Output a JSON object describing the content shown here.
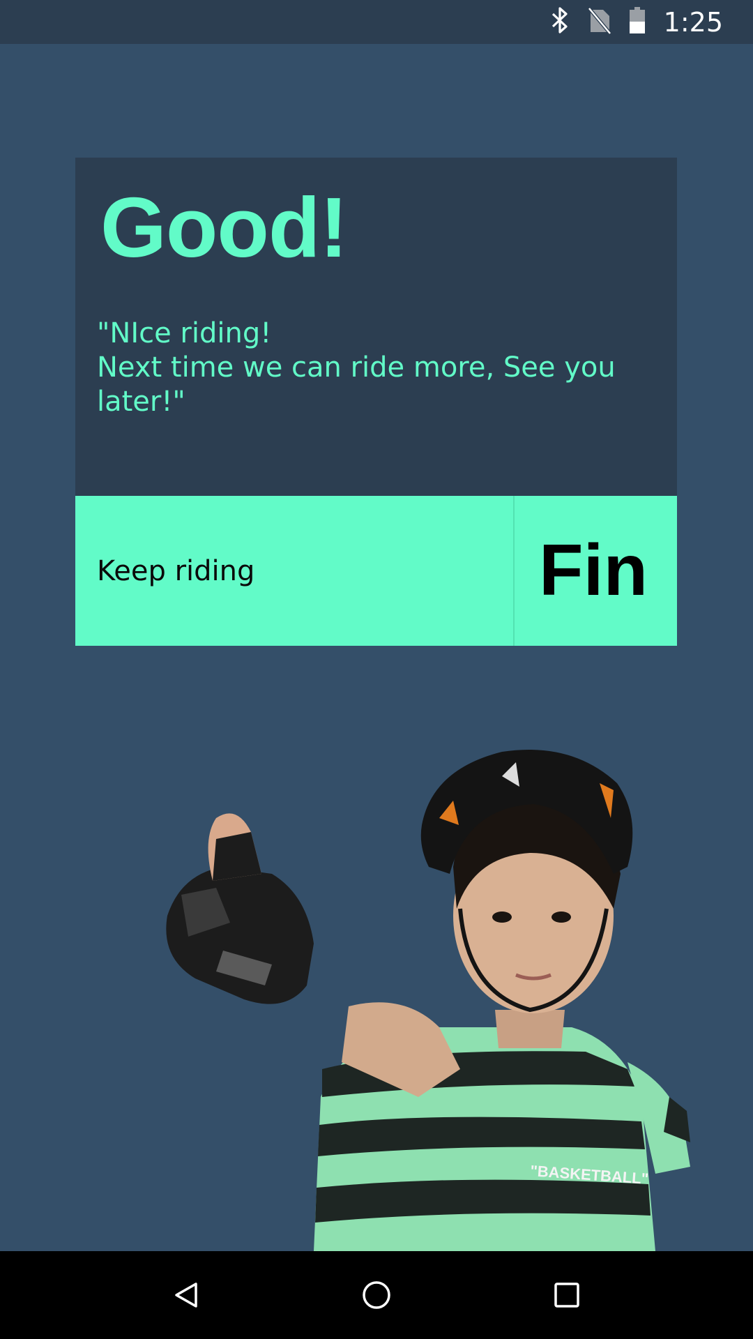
{
  "status_bar": {
    "time": "1:25",
    "icons": [
      "bluetooth-icon",
      "no-sim-icon",
      "battery-icon"
    ]
  },
  "card": {
    "title": "Good!",
    "message_line1": "\"NIce riding!",
    "message_line2": "Next time we can ride more, See you later!\"",
    "keep_label": "Keep riding",
    "fin_label": "Fin"
  },
  "illustration": {
    "description_icon": "kid-with-helmet-thumbs-up-image",
    "shirt_text": "\"BASKETBALL\""
  },
  "nav_bar": {
    "icons": [
      "back-icon",
      "home-icon",
      "recents-icon"
    ]
  },
  "colors": {
    "background": "#344f69",
    "card": "#2c3e51",
    "accent": "#62fbc8"
  }
}
